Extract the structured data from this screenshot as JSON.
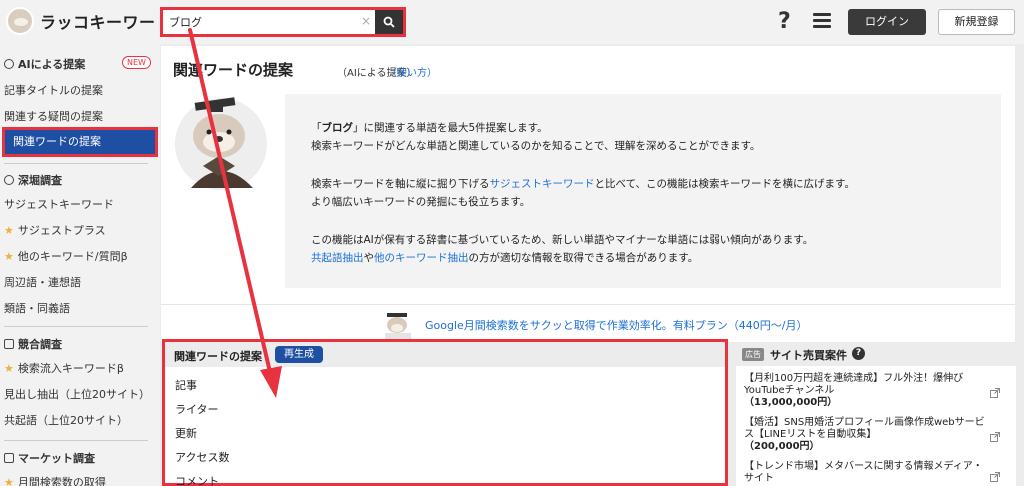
{
  "header": {
    "logo_text": "ラッコキーワード",
    "search_value": "ブログ",
    "clear_symbol": "×",
    "help_symbol": "?",
    "login_label": "ログイン",
    "register_label": "新規登録"
  },
  "sidebar": {
    "ai_section": "AIによる提案",
    "new_badge": "NEW",
    "ai_items": [
      "記事タイトルの提案",
      "関連する疑問の提案",
      "関連ワードの提案"
    ],
    "deep_section": "深堀調査",
    "deep_items": [
      "サジェストキーワード",
      "サジェストプラス",
      "他のキーワード/質問β",
      "周辺語・連想語",
      "類語・同義語"
    ],
    "comp_section": "競合調査",
    "comp_items": [
      "検索流入キーワードβ",
      "見出し抽出（上位20サイト）",
      "共起語（上位20サイト）"
    ],
    "market_section": "マーケット調査",
    "market_items": [
      "月間検索数の取得"
    ]
  },
  "card": {
    "title": "関連ワードの提案",
    "subtitle": "（AIによる提案）",
    "usage_link": "（使い方）",
    "info": {
      "l1_a": "「",
      "l1_kw": "ブログ",
      "l1_b": "」に関連する単語を最大5件提案します。",
      "l2": "検索キーワードがどんな単語と関連しているのかを知ることで、理解を深めることができます。",
      "l3_a": "検索キーワードを軸に縦に掘り下げる",
      "l3_link": "サジェストキーワード",
      "l3_b": "と比べて、この機能は検索キーワードを横に広げます。",
      "l4": "より幅広いキーワードの発掘にも役立ちます。",
      "l5": "この機能はAIが保有する辞書に基づいているため、新しい単語やマイナーな単語には弱い傾向があります。",
      "l6_link1": "共起語抽出",
      "l6_a": "や",
      "l6_link2": "他のキーワード抽出",
      "l6_b": "の方が適切な情報を取得できる場合があります。"
    },
    "promo": "Google月間検索数をサクッと取得で作業効率化。有料プラン（440円〜/月）"
  },
  "related": {
    "title": "関連ワードの提案",
    "regen_label": "再生成",
    "items": [
      "記事",
      "ライター",
      "更新",
      "アクセス数",
      "コメント"
    ]
  },
  "right": {
    "ad_badge": "広告",
    "title": "サイト売買案件",
    "help_symbol": "?",
    "sales": [
      {
        "text": "【月利100万円超を連続達成】フル外注！爆伸びYouTubeチャンネル",
        "price": "（13,000,000円）"
      },
      {
        "text": "【婚活】SNS用婚活プロフィール画像作成webサービス【LINEリストを自動収集】",
        "price": "（200,000円）"
      },
      {
        "text": "【トレンド市場】メタバースに関する情報メディア・サイト",
        "price": ""
      }
    ]
  },
  "colors": {
    "highlight_red": "#e8323f",
    "active_blue": "#1e4fa3",
    "link_blue": "#1d6fd6"
  }
}
